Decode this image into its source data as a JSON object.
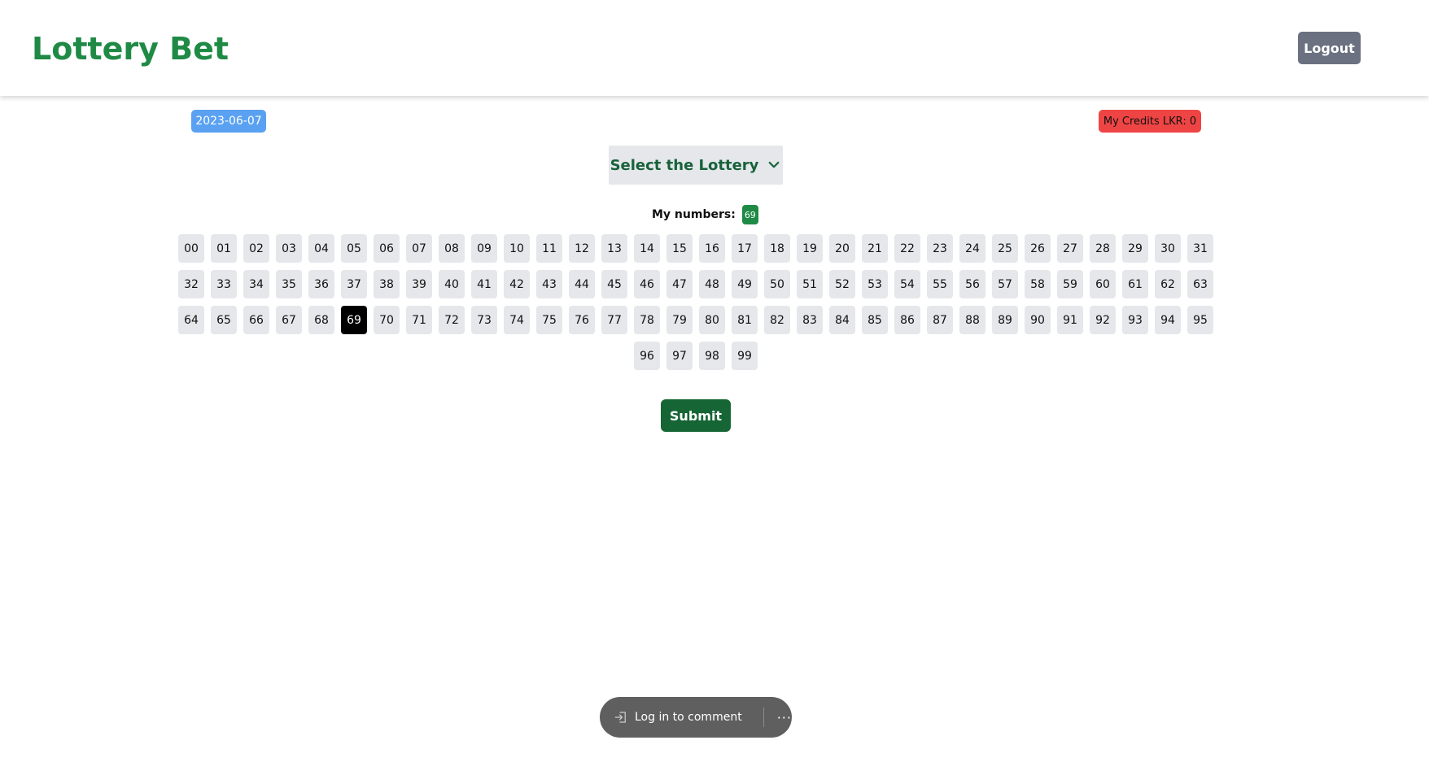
{
  "header": {
    "brand": "Lottery Bet",
    "logout_label": "Logout"
  },
  "info": {
    "date": "2023-06-07",
    "credits": "My Credits LKR: 0"
  },
  "lottery_select": {
    "label": "Select the Lottery",
    "icon": "chevron-down-icon"
  },
  "my_numbers": {
    "label": "My numbers:",
    "selected": [
      "69"
    ]
  },
  "numbers": [
    "00",
    "01",
    "02",
    "03",
    "04",
    "05",
    "06",
    "07",
    "08",
    "09",
    "10",
    "11",
    "12",
    "13",
    "14",
    "15",
    "16",
    "17",
    "18",
    "19",
    "20",
    "21",
    "22",
    "23",
    "24",
    "25",
    "26",
    "27",
    "28",
    "29",
    "30",
    "31",
    "32",
    "33",
    "34",
    "35",
    "36",
    "37",
    "38",
    "39",
    "40",
    "41",
    "42",
    "43",
    "44",
    "45",
    "46",
    "47",
    "48",
    "49",
    "50",
    "51",
    "52",
    "53",
    "54",
    "55",
    "56",
    "57",
    "58",
    "59",
    "60",
    "61",
    "62",
    "63",
    "64",
    "65",
    "66",
    "67",
    "68",
    "69",
    "70",
    "71",
    "72",
    "73",
    "74",
    "75",
    "76",
    "77",
    "78",
    "79",
    "80",
    "81",
    "82",
    "83",
    "84",
    "85",
    "86",
    "87",
    "88",
    "89",
    "90",
    "91",
    "92",
    "93",
    "94",
    "95",
    "96",
    "97",
    "98",
    "99"
  ],
  "submit_label": "Submit",
  "comment_bar": {
    "login_label": "Log in to comment",
    "more_label": "···",
    "login_icon": "sign-in-icon"
  },
  "colors": {
    "brand": "#1f8a45",
    "date_badge": "#5aa1f2",
    "credits_badge": "#ef4444",
    "submit": "#166534",
    "selected_number": "#000000"
  }
}
